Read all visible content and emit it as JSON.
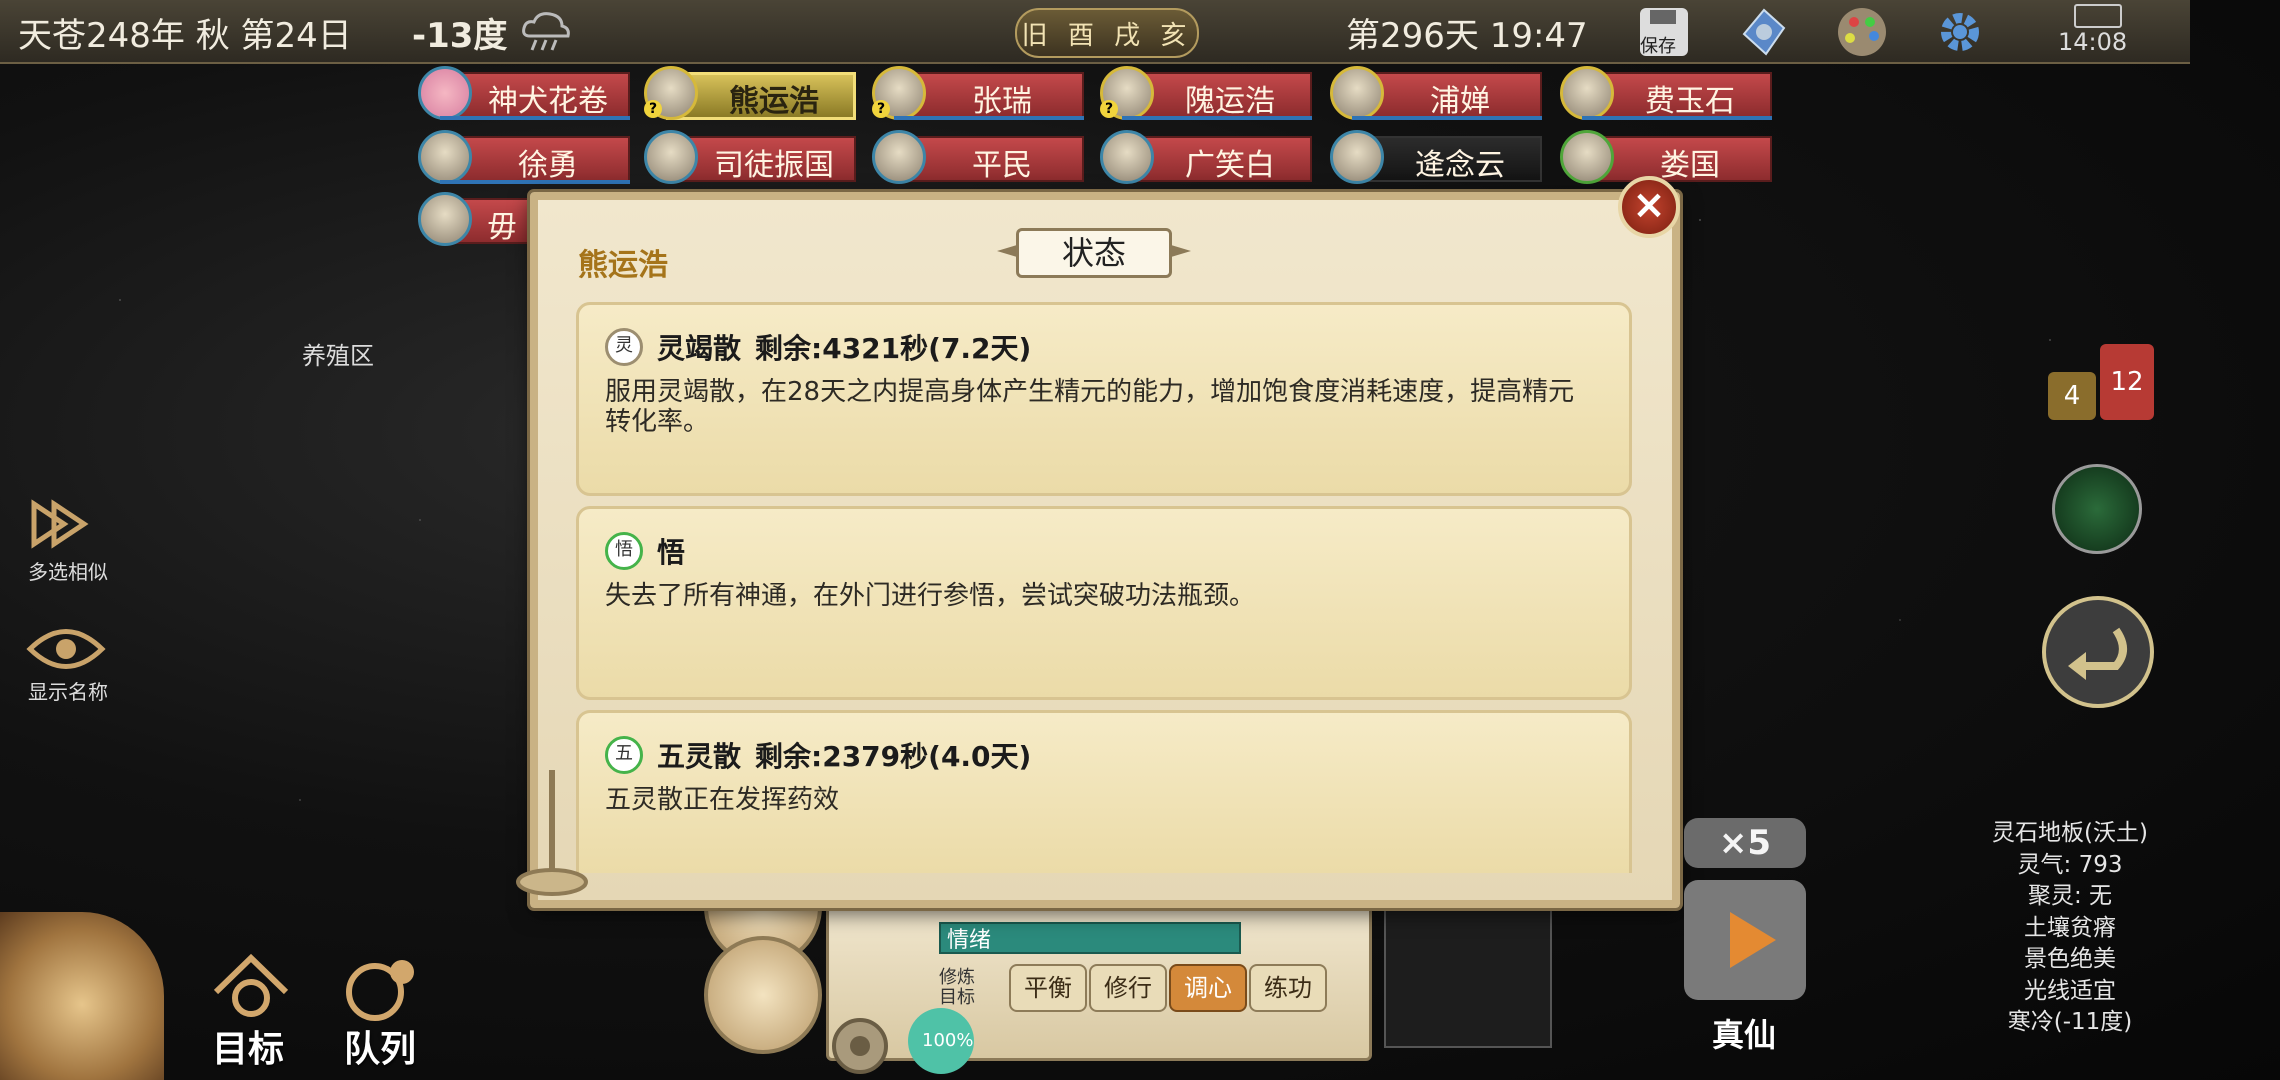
{
  "topbar": {
    "date": "天苍248年 秋 第24日",
    "temperature": "-13度",
    "weather_icon": "rain-cloud-icon",
    "season_badge": "旧 酉 戌 亥",
    "day_time": "第296天 19:47",
    "save_label": "保存",
    "clock": "14:08"
  },
  "characters": [
    {
      "name": "神犬花卷",
      "avatar": "paw-icon",
      "selected": false
    },
    {
      "name": "熊运浩",
      "avatar": "avatar-icon",
      "selected": true
    },
    {
      "name": "张瑞",
      "avatar": "avatar-icon",
      "selected": false
    },
    {
      "name": "隗运浩",
      "avatar": "avatar-icon",
      "selected": false
    },
    {
      "name": "浦婵",
      "avatar": "plus-icon",
      "selected": false
    },
    {
      "name": "费玉石",
      "avatar": "plus-icon",
      "selected": false
    },
    {
      "name": "徐勇",
      "avatar": "avatar-icon",
      "selected": false
    },
    {
      "name": "司徒振国",
      "avatar": "avatar-icon",
      "selected": false
    },
    {
      "name": "平民",
      "avatar": "avatar-icon",
      "selected": false
    },
    {
      "name": "广笑白",
      "avatar": "avatar-icon",
      "selected": false
    },
    {
      "name": "逄念云",
      "avatar": "avatar-icon",
      "selected": false
    },
    {
      "name": "娄国",
      "avatar": "avatar-icon",
      "selected": false
    },
    {
      "name": "毋",
      "avatar": "avatar-icon",
      "selected": false
    }
  ],
  "left_panel": {
    "zone_label": "养殖区",
    "multi_select_label": "多选相似",
    "show_names_label": "显示名称"
  },
  "modal": {
    "owner": "熊运浩",
    "title": "状态",
    "close_icon": "close-icon",
    "effects": [
      {
        "badge": "灵",
        "name": "灵竭散",
        "remaining": "剩余:4321秒(7.2天)",
        "desc": "服用灵竭散，在28天之内提高身体产生精元的能力，增加饱食度消耗速度，提高精元转化率。"
      },
      {
        "badge": "悟",
        "name": "悟",
        "remaining": "",
        "desc": "失去了所有神通，在外门进行参悟，尝试突破功法瓶颈。"
      },
      {
        "badge": "五",
        "name": "五灵散",
        "remaining": "剩余:2379秒(4.0天)",
        "desc": "五灵散正在发挥药效"
      }
    ]
  },
  "bottom": {
    "target_label": "目标",
    "queue_label": "队列",
    "mood_label": "情绪",
    "train_label": "修炼目标",
    "train_options": [
      "平衡",
      "修行",
      "调心",
      "练功"
    ],
    "train_active": "调心",
    "percent": "100%",
    "speed": "×5",
    "realm": "真仙"
  },
  "tile_info": {
    "title": "灵石地板(沃土)",
    "lines": [
      "灵气: 793",
      "聚灵: 无",
      "土壤贫瘠",
      "景色绝美",
      "光线适宜",
      "寒冷(-11度)"
    ]
  },
  "notifications": {
    "gold": "4",
    "red": "12"
  }
}
